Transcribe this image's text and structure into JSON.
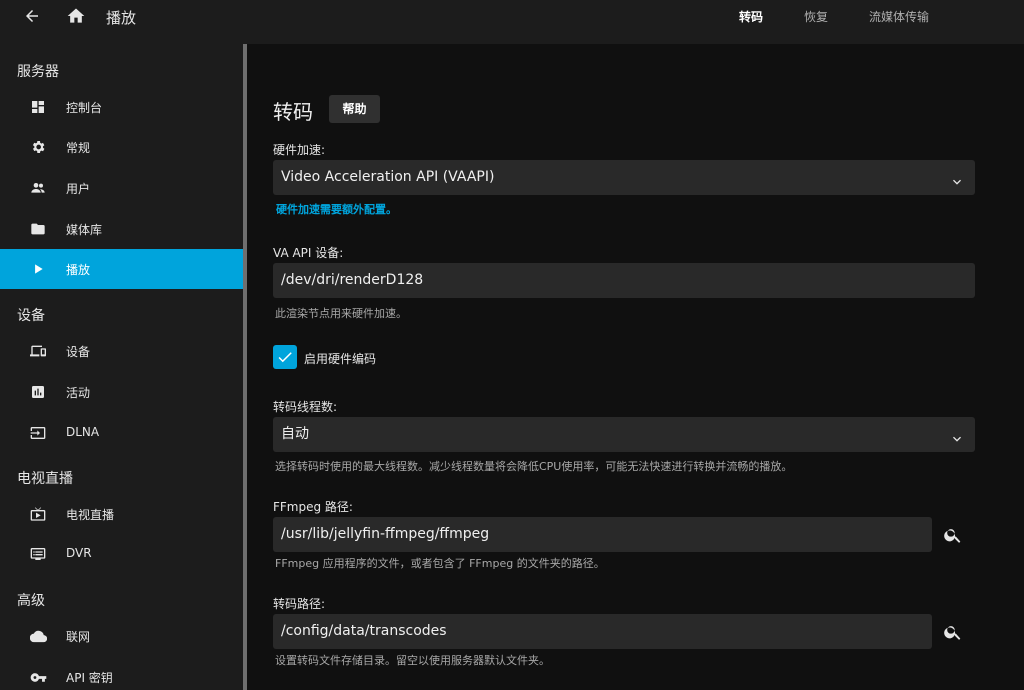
{
  "header": {
    "title": "播放",
    "tabs": [
      {
        "label": "转码"
      },
      {
        "label": "恢复"
      },
      {
        "label": "流媒体传输"
      }
    ]
  },
  "sidebar": {
    "sections": [
      {
        "heading": "服务器",
        "items": [
          {
            "label": "控制台",
            "icon": "dashboard-icon"
          },
          {
            "label": "常规",
            "icon": "gear-icon"
          },
          {
            "label": "用户",
            "icon": "users-icon"
          },
          {
            "label": "媒体库",
            "icon": "folder-icon"
          },
          {
            "label": "播放",
            "icon": "play-icon",
            "active": true
          }
        ]
      },
      {
        "heading": "设备",
        "items": [
          {
            "label": "设备",
            "icon": "devices-icon"
          },
          {
            "label": "活动",
            "icon": "activity-icon"
          },
          {
            "label": "DLNA",
            "icon": "input-icon"
          }
        ]
      },
      {
        "heading": "电视直播",
        "items": [
          {
            "label": "电视直播",
            "icon": "live-tv-icon"
          },
          {
            "label": "DVR",
            "icon": "dvr-icon"
          }
        ]
      },
      {
        "heading": "高级",
        "items": [
          {
            "label": "联网",
            "icon": "cloud-icon"
          },
          {
            "label": "API 密钥",
            "icon": "key-icon"
          }
        ]
      }
    ]
  },
  "main": {
    "title": "转码",
    "help_label": "帮助",
    "hw_accel": {
      "label": "硬件加速:",
      "value": "Video Acceleration API (VAAPI)",
      "link": "硬件加速需要额外配置。"
    },
    "va_device": {
      "label": "VA API 设备:",
      "value": "/dev/dri/renderD128",
      "desc": "此渲染节点用来硬件加速。"
    },
    "hw_encoding": {
      "label": "启用硬件编码",
      "checked": true
    },
    "threads": {
      "label": "转码线程数:",
      "value": "自动",
      "desc": "选择转码时使用的最大线程数。减少线程数量将会降低CPU使用率，可能无法快速进行转换并流畅的播放。"
    },
    "ffmpeg": {
      "label": "FFmpeg 路径:",
      "value": "/usr/lib/jellyfin-ffmpeg/ffmpeg",
      "desc": "FFmpeg 应用程序的文件，或者包含了 FFmpeg 的文件夹的路径。"
    },
    "transcode_path": {
      "label": "转码路径:",
      "value": "/config/data/transcodes",
      "desc": "设置转码文件存储目录。留空以使用服务器默认文件夹。"
    }
  },
  "colors": {
    "accent": "#00a4dc",
    "sidebar_bg": "#1c1c1c",
    "page_bg": "#101010",
    "field_bg": "#292929"
  }
}
